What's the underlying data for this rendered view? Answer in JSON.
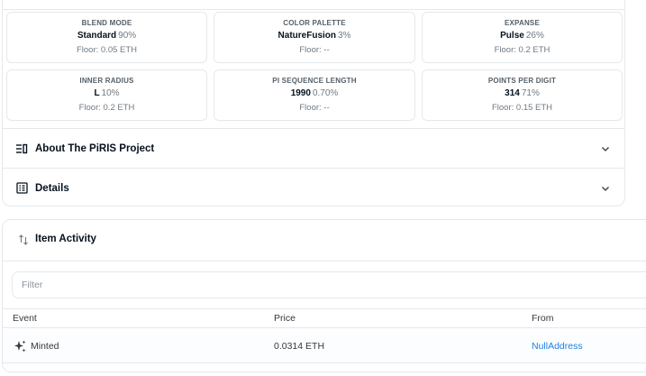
{
  "traits": [
    {
      "type": "Blend Mode",
      "value": "Standard",
      "percent": "90%",
      "floor": "Floor: 0.05 ETH"
    },
    {
      "type": "Color Palette",
      "value": "NatureFusion",
      "percent": "3%",
      "floor": "Floor: --"
    },
    {
      "type": "Expanse",
      "value": "Pulse",
      "percent": "26%",
      "floor": "Floor: 0.2 ETH"
    },
    {
      "type": "Inner Radius",
      "value": "L",
      "percent": "10%",
      "floor": "Floor: 0.2 ETH"
    },
    {
      "type": "Pi Sequence Length",
      "value": "1990",
      "percent": "0.70%",
      "floor": "Floor: --"
    },
    {
      "type": "Points Per Digit",
      "value": "314",
      "percent": "71%",
      "floor": "Floor: 0.15 ETH"
    }
  ],
  "sections": {
    "about": {
      "title": "About The PiRIS Project",
      "icon": "text-align-icon"
    },
    "details": {
      "title": "Details",
      "icon": "details-icon"
    }
  },
  "activity": {
    "title": "Item Activity",
    "icon": "swap-vertical-icon",
    "filter_placeholder": "Filter",
    "columns": {
      "event": "Event",
      "price": "Price",
      "from": "From"
    },
    "rows": [
      {
        "event": "Minted",
        "event_icon": "sparkle-icon",
        "price": "0.0314 ETH",
        "from": "NullAddress"
      }
    ]
  },
  "colors": {
    "accent": "#2081e2",
    "border": "#e5e8eb",
    "text": "#04111d",
    "muted": "#707a83"
  }
}
